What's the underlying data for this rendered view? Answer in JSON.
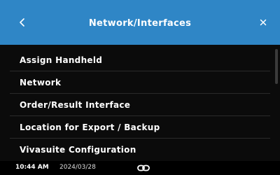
{
  "header": {
    "title": "Network/Interfaces",
    "back_icon": "chevron-left-icon",
    "close_icon": "close-icon",
    "background_color": "#2f86c6"
  },
  "menu": {
    "items": [
      {
        "label": "Assign Handheld"
      },
      {
        "label": "Network"
      },
      {
        "label": "Order/Result Interface"
      },
      {
        "label": "Location for Export / Backup"
      },
      {
        "label": "Vivasuite Configuration"
      }
    ]
  },
  "statusbar": {
    "time": "10:44 AM",
    "date": "2024/03/28",
    "connection_icon": "link-icon"
  }
}
